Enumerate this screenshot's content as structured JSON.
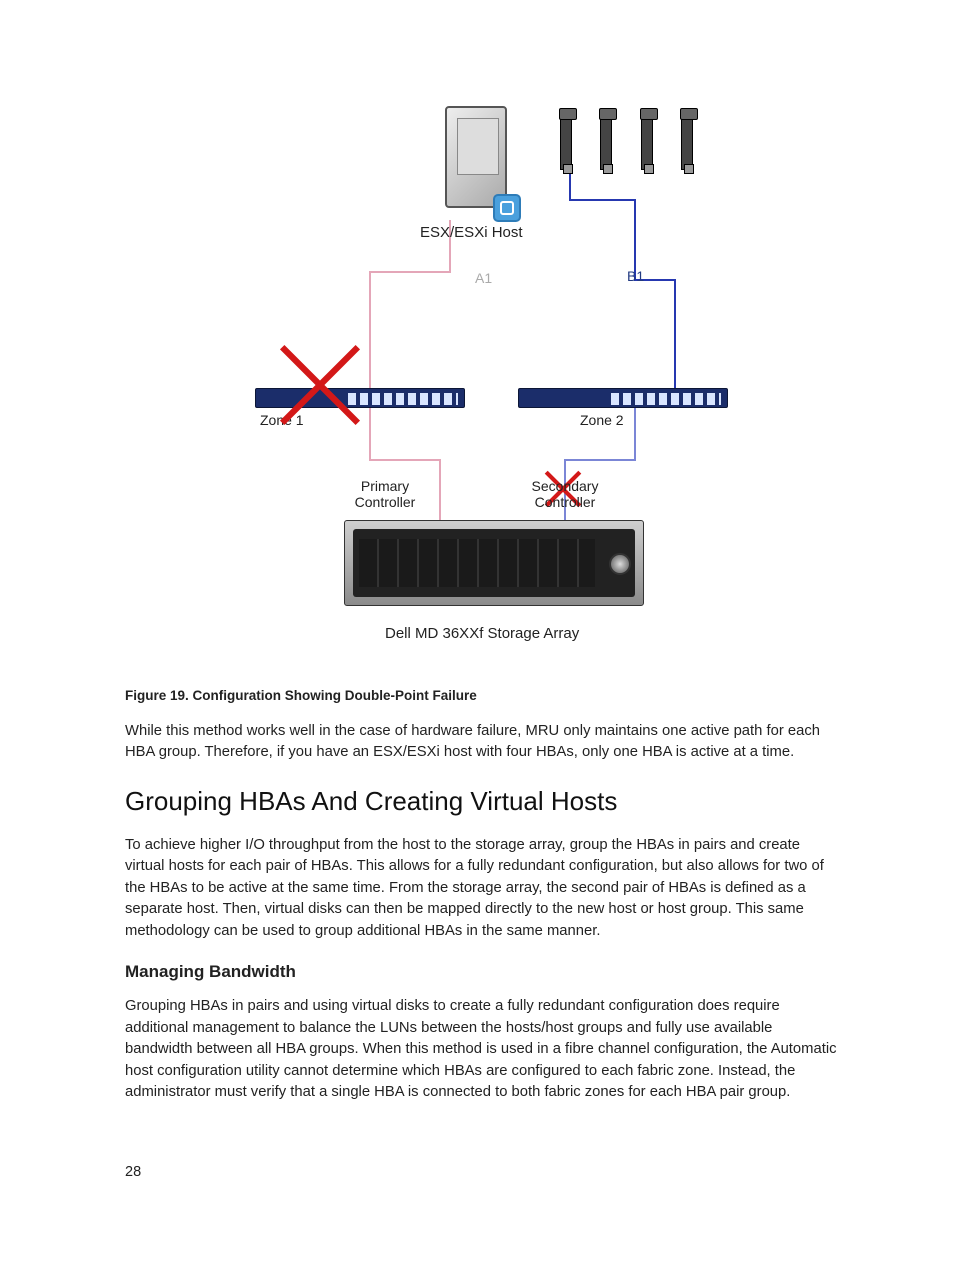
{
  "diagram": {
    "host_label": "ESX/ESXi Host",
    "path_a": "A1",
    "path_b": "B1",
    "zone1": "Zone 1",
    "zone2": "Zone 2",
    "primary_controller_line1": "Primary",
    "primary_controller_line2": "Controller",
    "secondary_controller_line1": "Secondary",
    "secondary_controller_line2": "Controller",
    "array_label": "Dell MD 36XXf Storage Array"
  },
  "figure_caption": "Figure 19. Configuration Showing Double-Point Failure",
  "para_after_figure": "While this method works well in the case of hardware failure, MRU only maintains one active path for each HBA group. Therefore, if you have an ESX/ESXi host with four HBAs, only one HBA is active at a time.",
  "section_heading": "Grouping HBAs And Creating Virtual Hosts",
  "section_body": "To achieve higher I/O throughput from the host to the storage array, group the HBAs in pairs and create virtual hosts for each pair of HBAs. This allows for a fully redundant configuration, but also allows for two of the HBAs to be active at the same time. From the storage array, the second pair of HBAs is defined as a separate host. Then, virtual disks can then be mapped directly to the new host or host group. This same methodology can be used to group additional HBAs in the same manner.",
  "subsection_heading": "Managing Bandwidth",
  "subsection_body": "Grouping HBAs in pairs and using virtual disks to create a fully redundant configuration does require additional management to balance the LUNs between the hosts/host groups and fully use available bandwidth between all HBA groups. When this method is used in a fibre channel configuration, the Automatic host configuration utility cannot determine which HBAs are configured to each fabric zone. Instead, the administrator must verify that a single HBA is connected to both fabric zones for each HBA pair group.",
  "page_number": "28"
}
